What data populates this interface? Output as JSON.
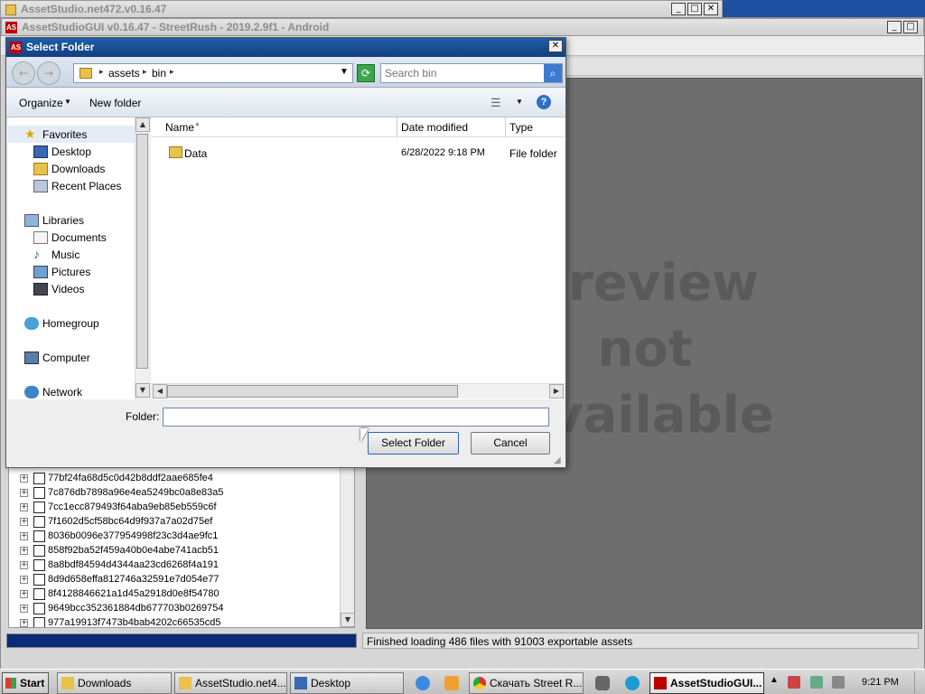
{
  "back_window": {
    "title": "AssetStudio.net472.v0.16.47"
  },
  "main_window": {
    "title": "AssetStudioGUI v0.16.47 - StreetRush - 2019.2.9f1 - Android",
    "icon_text": "AS"
  },
  "preview": {
    "line1": "Preview",
    "line2": "not",
    "line3": "available"
  },
  "status": {
    "text": "Finished loading 486 files with 91003 exportable assets"
  },
  "tree": {
    "items": [
      "77bf24fa68d5c0d42b8ddf2aae685fe4",
      "7c876db7898a96e4ea5249bc0a8e83a5",
      "7cc1ecc879493f64aba9eb85eb559c6f",
      "7f1602d5cf58bc64d9f937a7a02d75ef",
      "8036b0096e377954998f23c3d4ae9fc1",
      "858f92ba52f459a40b0e4abe741acb51",
      "8a8bdf84594d4344aa23cd6268f4a191",
      "8d9d658effa812746a32591e7d054e77",
      "8f4128846621a1d45a2918d0e8f54780",
      "9649bcc352361884db677703b0269754",
      "977a19913f7473b4bab4202c66535cd5"
    ]
  },
  "dialog": {
    "title": "Select Folder",
    "icon_text": "AS",
    "breadcrumb": [
      "assets",
      "bin"
    ],
    "search_placeholder": "Search bin",
    "organize_label": "Organize",
    "new_folder_label": "New folder",
    "nav": {
      "favorites": "Favorites",
      "desktop": "Desktop",
      "downloads": "Downloads",
      "recent": "Recent Places",
      "libraries": "Libraries",
      "documents": "Documents",
      "music": "Music",
      "pictures": "Pictures",
      "videos": "Videos",
      "homegroup": "Homegroup",
      "computer": "Computer",
      "network": "Network"
    },
    "columns": {
      "name": "Name",
      "date": "Date modified",
      "type": "Type"
    },
    "files": [
      {
        "name": "Data",
        "date": "6/28/2022 9:18 PM",
        "type": "File folder"
      }
    ],
    "folder_label": "Folder:",
    "folder_value": "",
    "select_button": "Select Folder",
    "cancel_button": "Cancel"
  },
  "taskbar": {
    "start_label": "Start",
    "tasks": [
      "Downloads",
      "AssetStudio.net4...",
      "Desktop",
      "Скачать Street R...",
      "AssetStudioGUI..."
    ],
    "clock": "9:21 PM"
  },
  "colors": {
    "accent": "#1e4fa0",
    "progress": "#0a2b7a",
    "preview_bg": "#6e6e6e"
  }
}
